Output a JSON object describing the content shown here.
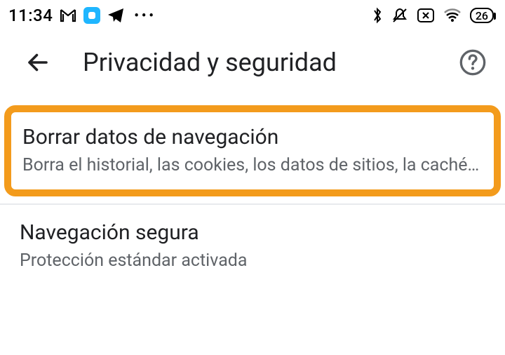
{
  "status": {
    "time": "11:34",
    "more_dots": "•••",
    "battery_percent": "26"
  },
  "header": {
    "title": "Privacidad y seguridad"
  },
  "items": [
    {
      "title": "Borrar datos de navegación",
      "subtitle": "Borra el historial, las cookies, los datos de sitios, la caché…"
    },
    {
      "title": "Navegación segura",
      "subtitle": "Protección estándar activada"
    }
  ]
}
